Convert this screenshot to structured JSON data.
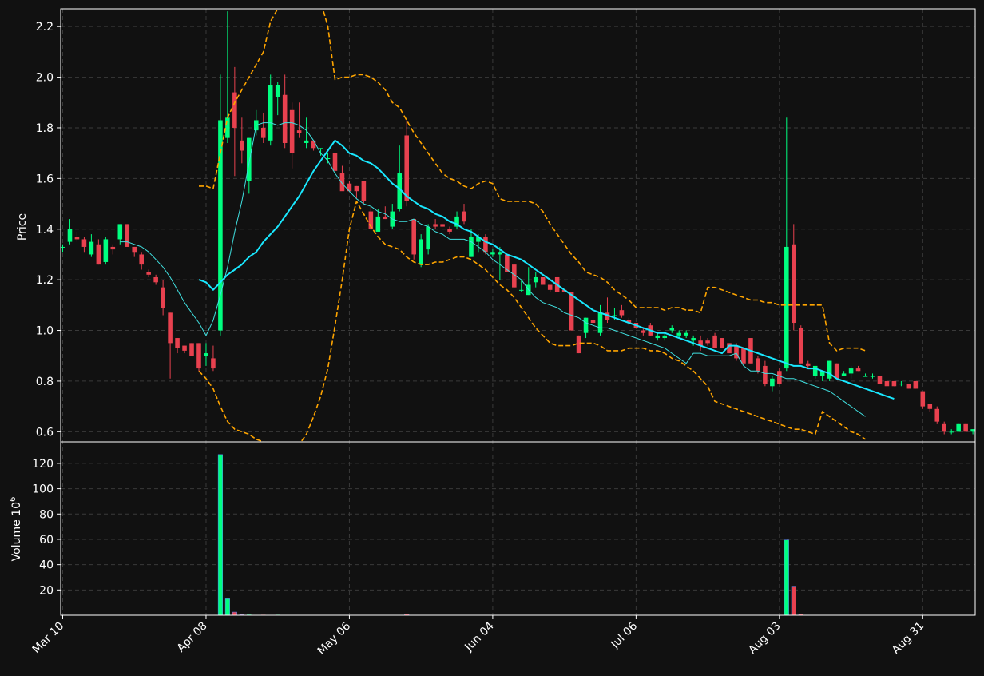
{
  "chart_data": {
    "type": "candlestick",
    "colors": {
      "background": "#111111",
      "up": "#00ff80",
      "down": "#e8414f",
      "grid": "#3a3a3a",
      "axis": "#ffffff",
      "ma_fast": "#40e0e0",
      "ma_slow": "#19e8ff",
      "bollinger": "#ffa500"
    },
    "panels": [
      {
        "id": "price",
        "ylabel": "Price",
        "ylim": [
          0.56,
          2.27
        ],
        "yticks": [
          "0.6",
          "0.8",
          "1.0",
          "1.2",
          "1.4",
          "1.6",
          "1.8",
          "2.0",
          "2.2"
        ],
        "ytick_values": [
          0.6,
          0.8,
          1.0,
          1.2,
          1.4,
          1.6,
          1.8,
          2.0,
          2.2
        ]
      },
      {
        "id": "volume",
        "ylabel": "Volume  10",
        "ylabel_exp": "6",
        "ylim": [
          0,
          137
        ],
        "yticks": [
          "20",
          "40",
          "60",
          "80",
          "100",
          "120"
        ],
        "ytick_values": [
          20,
          40,
          60,
          80,
          100,
          120
        ]
      }
    ],
    "x_tick_labels": [
      "Mar 10",
      "Apr 08",
      "May 06",
      "Jun 04",
      "Jul 06",
      "Aug 03",
      "Aug 31"
    ],
    "x_tick_index": [
      0,
      20,
      40,
      60,
      80,
      100,
      120
    ],
    "grid": true,
    "candles": [
      [
        1.33,
        1.34,
        1.31,
        1.33,
        0.1
      ],
      [
        1.35,
        1.44,
        1.34,
        1.4,
        0.1
      ],
      [
        1.37,
        1.39,
        1.35,
        1.36,
        0.1
      ],
      [
        1.36,
        1.37,
        1.31,
        1.33,
        0.1
      ],
      [
        1.3,
        1.38,
        1.29,
        1.35,
        0.1
      ],
      [
        1.34,
        1.36,
        1.26,
        1.26,
        0.1
      ],
      [
        1.27,
        1.37,
        1.26,
        1.36,
        0.1
      ],
      [
        1.33,
        1.34,
        1.3,
        1.32,
        0.1
      ],
      [
        1.36,
        1.42,
        1.34,
        1.42,
        0.1
      ],
      [
        1.42,
        1.42,
        1.33,
        1.33,
        0.1
      ],
      [
        1.33,
        1.33,
        1.29,
        1.31,
        0.1
      ],
      [
        1.3,
        1.31,
        1.24,
        1.26,
        0.1
      ],
      [
        1.23,
        1.24,
        1.21,
        1.22,
        0.1
      ],
      [
        1.21,
        1.22,
        1.18,
        1.19,
        0.1
      ],
      [
        1.17,
        1.2,
        1.06,
        1.09,
        0.1
      ],
      [
        1.07,
        1.07,
        0.81,
        0.95,
        0.2
      ],
      [
        0.97,
        0.97,
        0.91,
        0.93,
        0.1
      ],
      [
        0.94,
        0.94,
        0.91,
        0.92,
        0.1
      ],
      [
        0.95,
        0.95,
        0.9,
        0.9,
        0.1
      ],
      [
        0.95,
        0.95,
        0.84,
        0.85,
        0.2
      ],
      [
        0.9,
        0.95,
        0.86,
        0.91,
        0.3
      ],
      [
        0.89,
        0.94,
        0.84,
        0.85,
        0.2
      ],
      [
        1.0,
        2.01,
        0.98,
        1.83,
        127.0
      ],
      [
        1.76,
        2.26,
        1.74,
        1.84,
        13.0
      ],
      [
        1.94,
        2.04,
        1.61,
        1.8,
        2.5
      ],
      [
        1.75,
        1.84,
        1.66,
        1.71,
        0.6
      ],
      [
        1.59,
        1.76,
        1.54,
        1.76,
        0.5
      ],
      [
        1.79,
        1.87,
        1.77,
        1.83,
        0.3
      ],
      [
        1.8,
        1.86,
        1.74,
        1.76,
        0.4
      ],
      [
        1.75,
        2.01,
        1.73,
        1.97,
        0.3
      ],
      [
        1.92,
        1.98,
        1.85,
        1.97,
        0.4
      ],
      [
        1.93,
        2.01,
        1.72,
        1.74,
        0.2
      ],
      [
        1.87,
        1.9,
        1.64,
        1.7,
        0.3
      ],
      [
        1.79,
        1.9,
        1.76,
        1.78,
        0.2
      ],
      [
        1.74,
        1.84,
        1.72,
        1.75,
        0.3
      ],
      [
        1.75,
        1.75,
        1.71,
        1.72,
        0.2
      ],
      [
        1.72,
        1.72,
        1.69,
        1.72,
        0.1
      ],
      [
        1.68,
        1.7,
        1.66,
        1.68,
        0.1
      ],
      [
        1.7,
        1.71,
        1.6,
        1.63,
        0.2
      ],
      [
        1.62,
        1.65,
        1.56,
        1.55,
        0.2
      ],
      [
        1.58,
        1.59,
        1.55,
        1.55,
        0.1
      ],
      [
        1.57,
        1.57,
        1.52,
        1.55,
        0.1
      ],
      [
        1.59,
        1.59,
        1.5,
        1.51,
        0.2
      ],
      [
        1.47,
        1.49,
        1.4,
        1.4,
        0.2
      ],
      [
        1.39,
        1.48,
        1.39,
        1.45,
        0.2
      ],
      [
        1.45,
        1.49,
        1.44,
        1.44,
        0.1
      ],
      [
        1.41,
        1.5,
        1.4,
        1.47,
        0.1
      ],
      [
        1.48,
        1.73,
        1.47,
        1.62,
        0.3
      ],
      [
        1.77,
        1.83,
        1.49,
        1.51,
        1.0
      ],
      [
        1.44,
        1.44,
        1.28,
        1.3,
        0.2
      ],
      [
        1.26,
        1.38,
        1.25,
        1.36,
        0.3
      ],
      [
        1.32,
        1.42,
        1.3,
        1.41,
        0.2
      ],
      [
        1.42,
        1.44,
        1.4,
        1.41,
        0.1
      ],
      [
        1.42,
        1.42,
        1.41,
        1.41,
        0.1
      ],
      [
        1.4,
        1.41,
        1.38,
        1.39,
        0.1
      ],
      [
        1.41,
        1.47,
        1.4,
        1.45,
        0.1
      ],
      [
        1.47,
        1.5,
        1.42,
        1.43,
        0.1
      ],
      [
        1.29,
        1.4,
        1.29,
        1.37,
        0.1
      ],
      [
        1.35,
        1.38,
        1.31,
        1.37,
        0.1
      ],
      [
        1.37,
        1.38,
        1.3,
        1.31,
        0.1
      ],
      [
        1.3,
        1.32,
        1.29,
        1.31,
        0.1
      ],
      [
        1.3,
        1.33,
        1.2,
        1.31,
        0.1
      ],
      [
        1.3,
        1.3,
        1.23,
        1.23,
        0.2
      ],
      [
        1.26,
        1.26,
        1.17,
        1.17,
        0.1
      ],
      [
        1.16,
        1.2,
        1.15,
        1.16,
        0.1
      ],
      [
        1.14,
        1.25,
        1.14,
        1.18,
        0.1
      ],
      [
        1.19,
        1.23,
        1.17,
        1.21,
        0.1
      ],
      [
        1.21,
        1.21,
        1.18,
        1.18,
        0.1
      ],
      [
        1.18,
        1.18,
        1.15,
        1.16,
        0.1
      ],
      [
        1.21,
        1.21,
        1.15,
        1.15,
        0.1
      ],
      [
        1.16,
        1.16,
        1.15,
        1.15,
        0.1
      ],
      [
        1.15,
        1.15,
        1.0,
        1.0,
        0.2
      ],
      [
        0.98,
        0.98,
        0.91,
        0.91,
        0.2
      ],
      [
        0.99,
        1.05,
        0.97,
        1.05,
        0.2
      ],
      [
        1.04,
        1.05,
        1.02,
        1.03,
        0.1
      ],
      [
        0.99,
        1.1,
        0.98,
        1.07,
        0.2
      ],
      [
        1.07,
        1.13,
        1.03,
        1.04,
        0.1
      ],
      [
        1.06,
        1.09,
        1.04,
        1.06,
        0.1
      ],
      [
        1.08,
        1.1,
        1.05,
        1.06,
        0.1
      ],
      [
        1.04,
        1.05,
        1.02,
        1.03,
        0.1
      ],
      [
        1.03,
        1.03,
        1.01,
        1.01,
        0.1
      ],
      [
        1.0,
        1.01,
        0.98,
        0.99,
        0.1
      ],
      [
        1.02,
        1.03,
        0.98,
        0.98,
        0.1
      ],
      [
        0.97,
        0.99,
        0.96,
        0.98,
        0.1
      ],
      [
        0.97,
        0.99,
        0.96,
        0.98,
        0.1
      ],
      [
        1.0,
        1.02,
        0.99,
        1.01,
        0.1
      ],
      [
        0.98,
        1.0,
        0.97,
        0.99,
        0.1
      ],
      [
        0.98,
        1.0,
        0.97,
        0.99,
        0.1
      ],
      [
        0.96,
        0.98,
        0.94,
        0.97,
        0.1
      ],
      [
        0.96,
        0.98,
        0.92,
        0.94,
        0.1
      ],
      [
        0.96,
        0.97,
        0.94,
        0.95,
        0.1
      ],
      [
        0.98,
        0.99,
        0.93,
        0.93,
        0.1
      ],
      [
        0.97,
        0.97,
        0.93,
        0.93,
        0.1
      ],
      [
        0.95,
        0.95,
        0.91,
        0.91,
        0.1
      ],
      [
        0.94,
        0.95,
        0.88,
        0.89,
        0.1
      ],
      [
        0.93,
        0.93,
        0.87,
        0.87,
        0.1
      ],
      [
        0.97,
        0.97,
        0.87,
        0.87,
        0.1
      ],
      [
        0.89,
        0.9,
        0.83,
        0.84,
        0.1
      ],
      [
        0.86,
        0.88,
        0.78,
        0.79,
        0.1
      ],
      [
        0.78,
        0.82,
        0.76,
        0.81,
        0.1
      ],
      [
        0.84,
        0.85,
        0.79,
        0.79,
        0.1
      ],
      [
        0.85,
        1.84,
        0.84,
        1.33,
        59.5
      ],
      [
        1.34,
        1.42,
        1.0,
        1.03,
        23.0
      ],
      [
        1.01,
        1.02,
        0.87,
        0.87,
        1.0
      ],
      [
        0.87,
        0.88,
        0.85,
        0.86,
        0.2
      ],
      [
        0.82,
        0.86,
        0.81,
        0.86,
        0.1
      ],
      [
        0.82,
        0.84,
        0.8,
        0.84,
        0.1
      ],
      [
        0.81,
        0.88,
        0.8,
        0.88,
        0.1
      ],
      [
        0.87,
        0.87,
        0.81,
        0.81,
        0.1
      ],
      [
        0.82,
        0.84,
        0.82,
        0.83,
        0.1
      ],
      [
        0.83,
        0.86,
        0.81,
        0.85,
        0.1
      ],
      [
        0.85,
        0.86,
        0.84,
        0.84,
        0.1
      ],
      [
        0.82,
        0.83,
        0.82,
        0.82,
        0.1
      ],
      [
        0.82,
        0.83,
        0.81,
        0.82,
        0.1
      ],
      [
        0.82,
        0.82,
        0.79,
        0.79,
        0.1
      ],
      [
        0.8,
        0.8,
        0.78,
        0.78,
        0.1
      ],
      [
        0.8,
        0.8,
        0.78,
        0.78,
        0.1
      ],
      [
        0.79,
        0.8,
        0.78,
        0.79,
        0.1
      ],
      [
        0.79,
        0.79,
        0.77,
        0.77,
        0.1
      ],
      [
        0.8,
        0.8,
        0.77,
        0.77,
        0.1
      ],
      [
        0.76,
        0.76,
        0.69,
        0.7,
        0.1
      ],
      [
        0.71,
        0.71,
        0.68,
        0.69,
        0.1
      ],
      [
        0.69,
        0.7,
        0.63,
        0.64,
        0.1
      ],
      [
        0.63,
        0.64,
        0.59,
        0.6,
        0.1
      ],
      [
        0.6,
        0.61,
        0.59,
        0.6,
        0.1
      ],
      [
        0.6,
        0.63,
        0.6,
        0.63,
        0.1
      ],
      [
        0.63,
        0.63,
        0.6,
        0.6,
        0.1
      ],
      [
        0.6,
        0.61,
        0.59,
        0.61,
        0.1
      ]
    ],
    "ma_fast": {
      "start": 8,
      "values": [
        1.35,
        1.35,
        1.34,
        1.33,
        1.31,
        1.28,
        1.25,
        1.21,
        1.16,
        1.11,
        1.07,
        1.03,
        0.98,
        1.04,
        1.14,
        1.25,
        1.39,
        1.51,
        1.66,
        1.81,
        1.82,
        1.82,
        1.81,
        1.82,
        1.82,
        1.81,
        1.79,
        1.75,
        1.7,
        1.67,
        1.62,
        1.58,
        1.55,
        1.52,
        1.5,
        1.49,
        1.47,
        1.46,
        1.44,
        1.43,
        1.43,
        1.44,
        1.42,
        1.41,
        1.39,
        1.38,
        1.36,
        1.36,
        1.36,
        1.35,
        1.33,
        1.31,
        1.28,
        1.26,
        1.24,
        1.22,
        1.2,
        1.16,
        1.13,
        1.11,
        1.1,
        1.09,
        1.07,
        1.06,
        1.05,
        1.03,
        1.02,
        1.01,
        1.01,
        1.0,
        0.99,
        0.98,
        0.97,
        0.96,
        0.95,
        0.94,
        0.93,
        0.91,
        0.89,
        0.87,
        0.91,
        0.91,
        0.9,
        0.9,
        0.9,
        0.9,
        0.91,
        0.86,
        0.84,
        0.84,
        0.83,
        0.83,
        0.82,
        0.81,
        0.81,
        0.8,
        0.79,
        0.78,
        0.77,
        0.76,
        0.74,
        0.72,
        0.7,
        0.68,
        0.66
      ]
    },
    "ma_slow": {
      "start": 19,
      "values": [
        1.2,
        1.19,
        1.16,
        1.19,
        1.22,
        1.24,
        1.26,
        1.29,
        1.31,
        1.35,
        1.38,
        1.41,
        1.45,
        1.49,
        1.53,
        1.58,
        1.63,
        1.67,
        1.71,
        1.75,
        1.73,
        1.7,
        1.69,
        1.67,
        1.66,
        1.64,
        1.61,
        1.58,
        1.56,
        1.53,
        1.51,
        1.49,
        1.48,
        1.46,
        1.45,
        1.43,
        1.42,
        1.4,
        1.39,
        1.37,
        1.35,
        1.34,
        1.32,
        1.3,
        1.29,
        1.28,
        1.26,
        1.24,
        1.22,
        1.2,
        1.18,
        1.16,
        1.14,
        1.12,
        1.1,
        1.08,
        1.07,
        1.06,
        1.05,
        1.04,
        1.03,
        1.02,
        1.01,
        1.0,
        0.99,
        0.99,
        0.98,
        0.97,
        0.96,
        0.95,
        0.94,
        0.93,
        0.92,
        0.91,
        0.94,
        0.94,
        0.93,
        0.92,
        0.91,
        0.9,
        0.89,
        0.88,
        0.87,
        0.86,
        0.86,
        0.85,
        0.85,
        0.84,
        0.83,
        0.81,
        0.8,
        0.79,
        0.78,
        0.77,
        0.76,
        0.75,
        0.74,
        0.73
      ]
    },
    "bollinger_upper": {
      "start": 19,
      "values": [
        1.57,
        1.57,
        1.56,
        1.7,
        1.84,
        1.9,
        1.95,
        2.0,
        2.05,
        2.1,
        2.22,
        2.27,
        2.3,
        2.32,
        2.34,
        2.35,
        2.33,
        2.3,
        2.2,
        1.99,
        2.0,
        2.0,
        2.01,
        2.01,
        2.0,
        1.98,
        1.95,
        1.9,
        1.88,
        1.83,
        1.78,
        1.74,
        1.7,
        1.66,
        1.62,
        1.6,
        1.59,
        1.57,
        1.56,
        1.58,
        1.59,
        1.58,
        1.52,
        1.51,
        1.51,
        1.51,
        1.51,
        1.5,
        1.47,
        1.42,
        1.38,
        1.34,
        1.3,
        1.27,
        1.23,
        1.22,
        1.21,
        1.19,
        1.16,
        1.14,
        1.12,
        1.09,
        1.09,
        1.09,
        1.09,
        1.08,
        1.09,
        1.09,
        1.08,
        1.08,
        1.07,
        1.17,
        1.17,
        1.16,
        1.15,
        1.14,
        1.13,
        1.12,
        1.12,
        1.11,
        1.11,
        1.1,
        1.1,
        1.1,
        1.1,
        1.1,
        1.1,
        1.1,
        0.95,
        0.92,
        0.93,
        0.93,
        0.93,
        0.92
      ]
    },
    "bollinger_lower": {
      "start": 19,
      "values": [
        0.84,
        0.81,
        0.77,
        0.7,
        0.64,
        0.61,
        0.6,
        0.59,
        0.57,
        0.56,
        0.55,
        0.54,
        0.54,
        0.53,
        0.55,
        0.59,
        0.66,
        0.74,
        0.85,
        1.02,
        1.2,
        1.4,
        1.51,
        1.46,
        1.41,
        1.37,
        1.34,
        1.33,
        1.32,
        1.29,
        1.27,
        1.26,
        1.26,
        1.27,
        1.27,
        1.28,
        1.29,
        1.29,
        1.28,
        1.26,
        1.24,
        1.21,
        1.18,
        1.16,
        1.13,
        1.09,
        1.05,
        1.01,
        0.98,
        0.95,
        0.94,
        0.94,
        0.94,
        0.95,
        0.95,
        0.95,
        0.94,
        0.92,
        0.92,
        0.92,
        0.93,
        0.93,
        0.93,
        0.92,
        0.92,
        0.91,
        0.89,
        0.88,
        0.86,
        0.84,
        0.81,
        0.78,
        0.72,
        0.71,
        0.7,
        0.69,
        0.68,
        0.67,
        0.66,
        0.65,
        0.64,
        0.63,
        0.62,
        0.61,
        0.61,
        0.6,
        0.59,
        0.68,
        0.66,
        0.64,
        0.62,
        0.6,
        0.59,
        0.57
      ]
    }
  }
}
